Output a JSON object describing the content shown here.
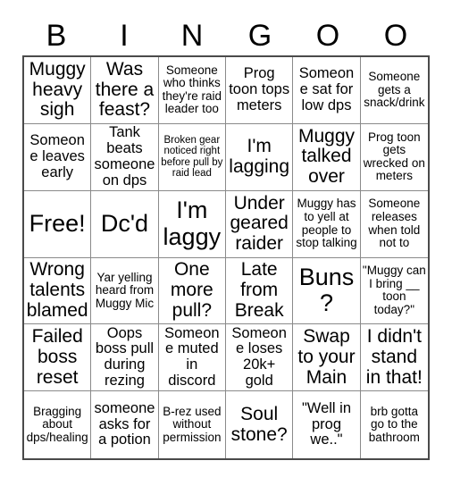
{
  "card": {
    "header_letters": [
      "B",
      "I",
      "N",
      "G",
      "O",
      "O"
    ],
    "columns": 6,
    "rows": 6,
    "colors": {
      "background": "#ffffff",
      "text": "#000000",
      "grid_line": "#8a8a8a",
      "outer_border": "#4a4a4a"
    },
    "cells": [
      {
        "text": "Muggy heavy sigh",
        "size": "fs-lg"
      },
      {
        "text": "Was there a feast?",
        "size": "fs-lg"
      },
      {
        "text": "Someone who thinks they're raid leader too",
        "size": "fs-sm"
      },
      {
        "text": "Prog toon tops meters",
        "size": "fs-md"
      },
      {
        "text": "Someone sat for low dps",
        "size": "fs-md"
      },
      {
        "text": "Someone gets a snack/drink",
        "size": "fs-sm"
      },
      {
        "text": "Someone leaves early",
        "size": "fs-md"
      },
      {
        "text": "Tank beats someone on dps",
        "size": "fs-md"
      },
      {
        "text": "Broken gear noticed right before pull by raid lead",
        "size": "fs-xs"
      },
      {
        "text": "I'm lagging",
        "size": "fs-lg"
      },
      {
        "text": "Muggy talked over",
        "size": "fs-lg"
      },
      {
        "text": "Prog toon gets wrecked on meters",
        "size": "fs-sm"
      },
      {
        "text": "Free!",
        "size": "fs-xl"
      },
      {
        "text": "Dc'd",
        "size": "fs-xl"
      },
      {
        "text": "I'm laggy",
        "size": "fs-xl"
      },
      {
        "text": "Under geared raider",
        "size": "fs-lg"
      },
      {
        "text": "Muggy has to yell at people to stop talking",
        "size": "fs-sm"
      },
      {
        "text": "Someone releases when told not to",
        "size": "fs-sm"
      },
      {
        "text": "Wrong talents blamed",
        "size": "fs-lg"
      },
      {
        "text": "Yar yelling heard from Muggy Mic",
        "size": "fs-sm"
      },
      {
        "text": "One more pull?",
        "size": "fs-lg"
      },
      {
        "text": "Late from Break",
        "size": "fs-lg"
      },
      {
        "text": "Buns?",
        "size": "fs-xl"
      },
      {
        "text": "\"Muggy can I bring __ toon today?\"",
        "size": "fs-sm"
      },
      {
        "text": "Failed boss reset",
        "size": "fs-lg"
      },
      {
        "text": "Oops boss pull during rezing",
        "size": "fs-md"
      },
      {
        "text": "Someone muted in discord",
        "size": "fs-md"
      },
      {
        "text": "Someone loses 20k+ gold",
        "size": "fs-md"
      },
      {
        "text": "Swap to your Main",
        "size": "fs-lg"
      },
      {
        "text": "I didn't stand in that!",
        "size": "fs-lg"
      },
      {
        "text": "Bragging about dps/healing",
        "size": "fs-sm"
      },
      {
        "text": "someone asks for a potion",
        "size": "fs-md"
      },
      {
        "text": "B-rez used without permission",
        "size": "fs-sm"
      },
      {
        "text": "Soul stone?",
        "size": "fs-lg"
      },
      {
        "text": "\"Well in prog we..\"",
        "size": "fs-md"
      },
      {
        "text": "brb gotta go to the bathroom",
        "size": "fs-sm"
      }
    ]
  }
}
